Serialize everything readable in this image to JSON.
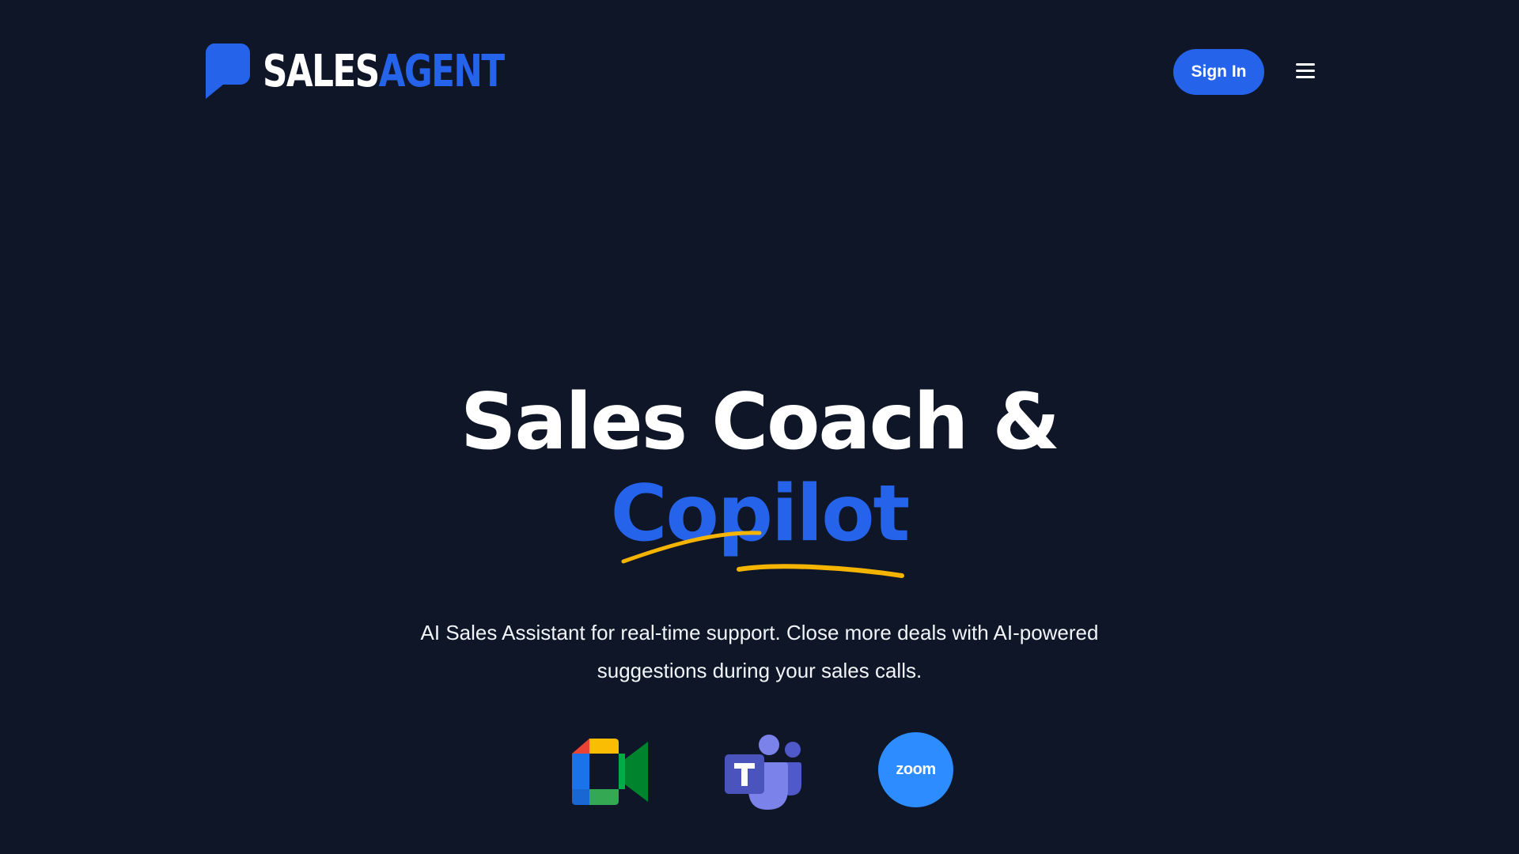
{
  "header": {
    "logo": {
      "part1": "SALES",
      "part2": "AGENT",
      "icon": "speech-bubble-icon"
    },
    "signin_label": "Sign In",
    "menu_icon": "hamburger-menu-icon"
  },
  "hero": {
    "title_line1": "Sales Coach &",
    "title_accent": "Copilot",
    "subtitle": "AI Sales Assistant for real-time support. Close more deals with AI-powered suggestions during your sales calls."
  },
  "integrations": [
    {
      "name": "google-meet",
      "icon": "google-meet-icon"
    },
    {
      "name": "microsoft-teams",
      "icon": "microsoft-teams-icon"
    },
    {
      "name": "zoom",
      "icon": "zoom-icon",
      "label": "zoom"
    }
  ],
  "colors": {
    "background": "#0e1628",
    "accent": "#2563eb",
    "underline": "#f5b400",
    "text": "#ffffff"
  }
}
